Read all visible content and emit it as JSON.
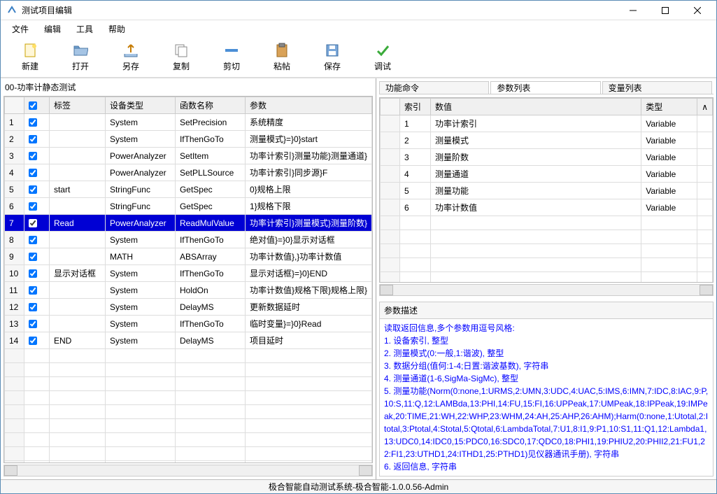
{
  "window": {
    "title": "测试项目编辑"
  },
  "menu": {
    "file": "文件",
    "edit": "编辑",
    "tools": "工具",
    "help": "帮助"
  },
  "toolbar": {
    "new": "新建",
    "open": "打开",
    "saveas": "另存",
    "copy": "复制",
    "cut": "剪切",
    "paste": "粘帖",
    "save": "保存",
    "debug": "调试"
  },
  "left": {
    "header": "00-功率计静态测试",
    "cols": {
      "check": "",
      "label": "标签",
      "devtype": "设备类型",
      "func": "函数名称",
      "params": "参数"
    },
    "rows": [
      {
        "n": "1",
        "checked": true,
        "label": "",
        "dev": "System",
        "func": "SetPrecision",
        "params": "系统精度"
      },
      {
        "n": "2",
        "checked": true,
        "label": "",
        "dev": "System",
        "func": "IfThenGoTo",
        "params": "测量模式}=}0}start"
      },
      {
        "n": "3",
        "checked": true,
        "label": "",
        "dev": "PowerAnalyzer",
        "func": "SetItem",
        "params": "功率计索引}测量功能}测量通道}"
      },
      {
        "n": "4",
        "checked": true,
        "label": "",
        "dev": "PowerAnalyzer",
        "func": "SetPLLSource",
        "params": "功率计索引}同步源}F"
      },
      {
        "n": "5",
        "checked": true,
        "label": "start",
        "dev": "StringFunc",
        "func": "GetSpec",
        "params": "0}规格上限"
      },
      {
        "n": "6",
        "checked": true,
        "label": "",
        "dev": "StringFunc",
        "func": "GetSpec",
        "params": "1}规格下限"
      },
      {
        "n": "7",
        "checked": true,
        "label": "Read",
        "dev": "PowerAnalyzer",
        "func": "ReadMulValue",
        "params": "功率计索引}测量模式}测量阶数}"
      },
      {
        "n": "8",
        "checked": true,
        "label": "",
        "dev": "System",
        "func": "IfThenGoTo",
        "params": "绝对值}=}0}显示对话框"
      },
      {
        "n": "9",
        "checked": true,
        "label": "",
        "dev": "MATH",
        "func": "ABSArray",
        "params": "功率计数值},}功率计数值"
      },
      {
        "n": "10",
        "checked": true,
        "label": "显示对话框",
        "dev": "System",
        "func": "IfThenGoTo",
        "params": "显示对话框}=}0}END"
      },
      {
        "n": "11",
        "checked": true,
        "label": "",
        "dev": "System",
        "func": "HoldOn",
        "params": "功率计数值}规格下限}规格上限}"
      },
      {
        "n": "12",
        "checked": true,
        "label": "",
        "dev": "System",
        "func": "DelayMS",
        "params": "更新数据延时"
      },
      {
        "n": "13",
        "checked": true,
        "label": "",
        "dev": "System",
        "func": "IfThenGoTo",
        "params": "临时变量}=}0}Read"
      },
      {
        "n": "14",
        "checked": true,
        "label": "END",
        "dev": "System",
        "func": "DelayMS",
        "params": "项目延时"
      }
    ],
    "selected_index": 6
  },
  "right_tabs": {
    "tab1": "功能命令",
    "tab2": "参数列表",
    "tab3": "变量列表"
  },
  "params": {
    "cols": {
      "index": "索引",
      "value": "数值",
      "type": "类型"
    },
    "rows": [
      {
        "i": "1",
        "v": "功率计索引",
        "t": "Variable"
      },
      {
        "i": "2",
        "v": "测量模式",
        "t": "Variable"
      },
      {
        "i": "3",
        "v": "测量阶数",
        "t": "Variable"
      },
      {
        "i": "4",
        "v": "测量通道",
        "t": "Variable"
      },
      {
        "i": "5",
        "v": "测量功能",
        "t": "Variable"
      },
      {
        "i": "6",
        "v": "功率计数值",
        "t": "Variable"
      }
    ]
  },
  "desc": {
    "header": "参数描述",
    "lines": [
      "读取返回信息,多个参数用逗号风格:",
      "1. 设备索引, 整型",
      "2. 测量模式(0:一般,1:谐波), 整型",
      "3. 数据分组(值何:1-4;日置:谐波基数), 字符串",
      "4. 测量通道(1-6,SigMa-SigMc), 整型",
      "5. 测量功能(Norm(0:none,1:URMS,2:UMN,3:UDC,4:UAC,5:IMS,6:IMN,7:IDC,8:IAC,9:P,10:S,11:Q,12:LAMBda,13:PHI,14:FU,15:FI,16:UPPeak,17:UMPeak,18:IPPeak,19:IMPeak,20:TIME,21:WH,22:WHP,23:WHM,24:AH,25:AHP,26:AHM);Harm(0:none,1:Utotal,2:Itotal,3:Ptotal,4:Stotal,5:Qtotal,6:LambdaTotal,7:U1,8:I1,9:P1,10:S1,11:Q1,12:Lambda1,13:UDC0,14:IDC0,15:PDC0,16:SDC0,17:QDC0,18:PHI1,19:PHIU2,20:PHII2,21:FU1,22:FI1,23:UTHD1,24:ITHD1,25:PTHD1)见仪器通讯手册), 字符串",
      "6. 返回信息, 字符串"
    ]
  },
  "status": "极合智能自动测试系统-极合智能-1.0.0.56-Admin"
}
